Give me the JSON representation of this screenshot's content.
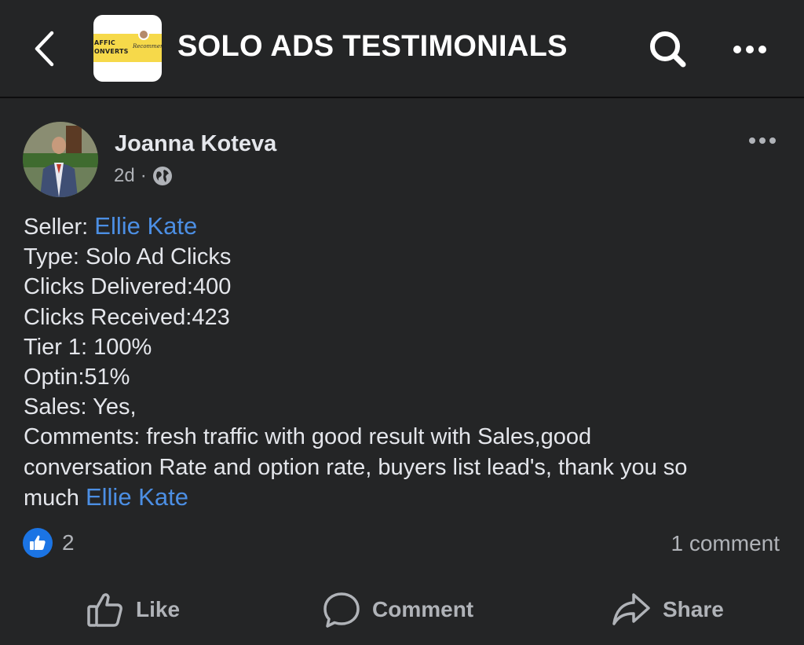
{
  "header": {
    "title": "SOLO ADS TESTIMONIALS",
    "back_icon": "chevron-left-icon",
    "search_icon": "search-icon",
    "more_icon": "more-horizontal-icon",
    "thumbnail": {
      "line1": "AFFIC",
      "line2": "ONVERTS",
      "script": "Recommended"
    }
  },
  "post": {
    "author": "Joanna Koteva",
    "time": "2d",
    "separator": "·",
    "privacy_icon": "globe-icon",
    "lines": [
      {
        "label": "Seller: ",
        "mention": "Ellie Kate"
      },
      {
        "text": "Type: Solo Ad Clicks"
      },
      {
        "text": "Clicks Delivered:400"
      },
      {
        "text": "Clicks Received:423"
      },
      {
        "text": "Tier 1: 100%"
      },
      {
        "text": "Optin:51%"
      },
      {
        "text": "Sales: Yes,"
      },
      {
        "text": "Comments: fresh traffic with good result with Sales,good"
      },
      {
        "text": "conversation Rate and option rate, buyers list lead's, thank you so"
      },
      {
        "label": "much ",
        "mention": "Ellie Kate"
      }
    ],
    "reaction_count": "2",
    "comment_count": "1 comment"
  },
  "actions": {
    "like": "Like",
    "comment": "Comment",
    "share": "Share"
  },
  "colors": {
    "background": "#242526",
    "text": "#e4e6eb",
    "secondary_text": "#b0b3b8",
    "link": "#4c8fe4",
    "like_blue": "#1b74e4"
  }
}
